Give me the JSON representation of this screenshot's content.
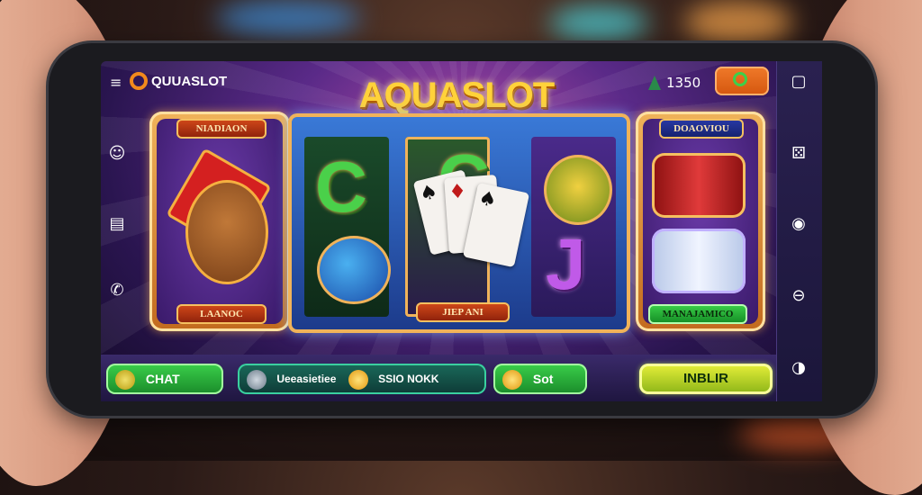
{
  "app": {
    "brand": "QUUASLOT",
    "title": "AQUASLOT",
    "balance": "1350"
  },
  "reels": {
    "left_top_label": "NIADIAON",
    "left_bottom_label": "LAANOC",
    "center_bottom_label": "JIEP ANI",
    "right_top_label": "DOAOVIOU",
    "right_bottom_label": "MANAJAMICO",
    "symbol_c1": "C",
    "symbol_c2": "C",
    "symbol_j": "J"
  },
  "bottom_bar": {
    "chat_label": "CHAT",
    "middle_left_label": "Ueeasietiee",
    "middle_right_label": "SSIO NOKK",
    "slot_label": "Sot",
    "cta_label": "INBLIR"
  },
  "colors": {
    "accent_orange": "#f28a1c",
    "title_gold": "#ffd23a",
    "button_green": "#3ad04a",
    "cta_lime": "#e8f03a"
  },
  "icons": {
    "menu": "≡",
    "left_col": [
      "face-icon",
      "chart-icon",
      "phone-icon"
    ],
    "right_col": [
      "square-icon",
      "dice-icon",
      "record-icon",
      "minus-icon",
      "shield-icon"
    ]
  }
}
